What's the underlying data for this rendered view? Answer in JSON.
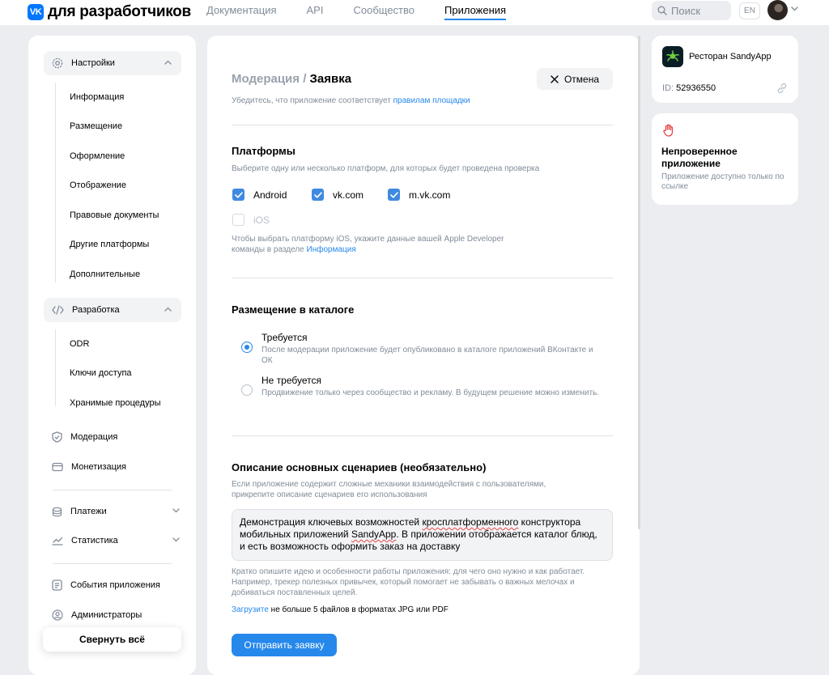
{
  "header": {
    "logo_mark": "VK",
    "logo_text": "для разработчиков",
    "nav": [
      {
        "label": "Документация",
        "active": false
      },
      {
        "label": "API",
        "active": false
      },
      {
        "label": "Сообщество",
        "active": false
      },
      {
        "label": "Приложения",
        "active": true
      }
    ],
    "search_placeholder": "Поиск",
    "lang": "EN"
  },
  "sidebar": {
    "settings": {
      "label": "Настройки",
      "icon": "gear-icon",
      "items": [
        "Информация",
        "Размещение",
        "Оформление",
        "Отображение",
        "Правовые документы",
        "Другие платформы",
        "Дополнительные"
      ]
    },
    "dev": {
      "label": "Разработка",
      "icon": "code-icon",
      "items": [
        "ODR",
        "Ключи доступа",
        "Хранимые процедуры"
      ]
    },
    "items": [
      {
        "label": "Модерация",
        "icon": "shield-icon"
      },
      {
        "label": "Монетизация",
        "icon": "wallet-icon"
      },
      {
        "label": "Платежи",
        "icon": "coins-icon"
      },
      {
        "label": "Статистика",
        "icon": "chart-icon"
      },
      {
        "label": "События приложения",
        "icon": "list-icon"
      },
      {
        "label": "Администраторы",
        "icon": "user-icon"
      }
    ],
    "collapse_label": "Свернуть всё"
  },
  "main": {
    "breadcrumb_parent": "Модерация /",
    "breadcrumb_current": "Заявка",
    "cancel_label": "Отмена",
    "intro_text": "Убедитесь, что приложение соответствует ",
    "intro_link": "правилам площадки",
    "platforms": {
      "title": "Платформы",
      "hint": "Выберите одну или несколько платформ, для которых будет проведена проверка",
      "options": [
        {
          "label": "Android",
          "checked": true
        },
        {
          "label": "vk.com",
          "checked": true
        },
        {
          "label": "m.vk.com",
          "checked": true
        },
        {
          "label": "iOS",
          "checked": false,
          "disabled": true
        }
      ],
      "ios_note_1": "Чтобы выбрать платформу iOS, укажите данные вашей Apple Developer",
      "ios_note_2": "команды в разделе ",
      "ios_note_link": "Информация"
    },
    "catalog": {
      "title": "Размещение в каталоге",
      "options": [
        {
          "title": "Требуется",
          "desc": "После модерации приложение будет опубликовано в каталоге приложений ВКонтакте и ОК",
          "selected": true
        },
        {
          "title": "Не требуется",
          "desc": "Продвижение только через сообщество и рекламу. В будущем решение можно изменить.",
          "selected": false
        }
      ]
    },
    "scenarios": {
      "title": "Описание основных сценариев (необязательно)",
      "hint": "Если приложение содержит сложные механики взаимодействия с пользователями, прикрепите описание сценариев его использования",
      "text_1": "Демонстрация ключевых возможностей ",
      "text_spell_1": "кросплатформенного",
      "text_2": " конструктора мобильных приложений ",
      "text_spell_2": "SandyApp",
      "text_3": ". В приложении отображается каталог блюд, и есть возможность оформить заказ на доставку",
      "help": "Кратко опишите идею и особенности работы приложения: для чего оно нужно и как работает. Например, трекер полезных привычек, который помогает не забывать о важных мелочах и добиваться поставленных целей.",
      "upload_link": "Загрузите",
      "upload_text": " не больше 5 файлов в форматах JPG или PDF"
    },
    "submit_label": "Отправить заявку"
  },
  "app_card": {
    "name": "Ресторан SandyApp",
    "id_label": "ID: ",
    "id_value": "52936550"
  },
  "status_card": {
    "title": "Непроверенное приложение",
    "desc": "Приложение доступно только по ссылке"
  },
  "colors": {
    "accent": "#2688eb",
    "checkbox": "#3f8ae0",
    "warning": "#e64646",
    "background": "#ebedf0"
  }
}
